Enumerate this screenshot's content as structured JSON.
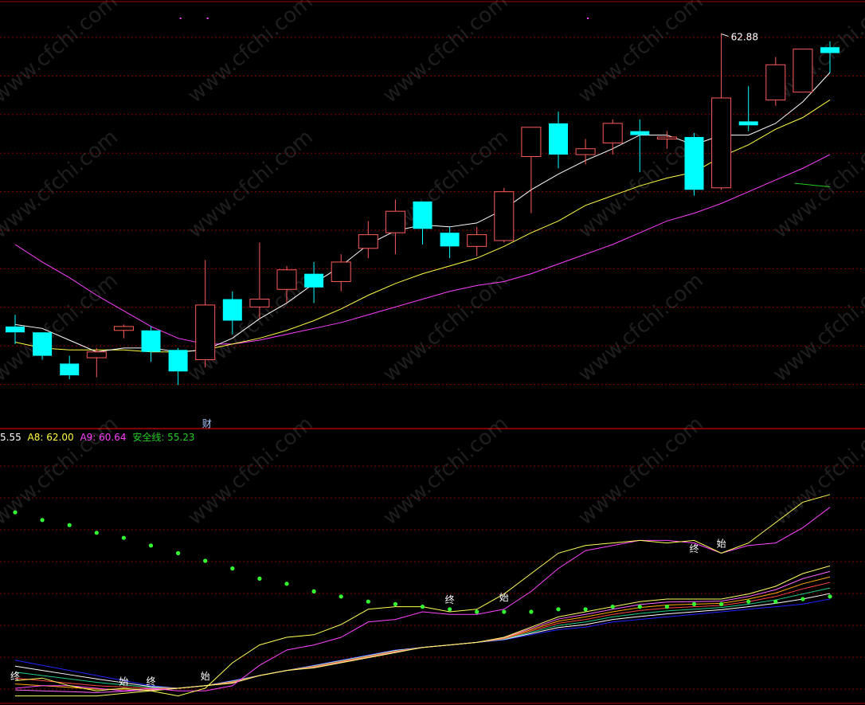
{
  "colors": {
    "up": "#ff5a5a",
    "down": "#00ffff",
    "ma1": "#ffffff",
    "ma2": "#ffff40",
    "ma3": "#ff40ff",
    "safety_line": "#22cc22",
    "grid": "#8b0000",
    "divider": "#aa0000",
    "dots": "#33ff33",
    "lower_yellow": "#ffff55",
    "lower_magenta": "#ff44ff"
  },
  "watermark": "www.cfchi.com",
  "legend": [
    {
      "text": "5.55",
      "color": "#ffffff"
    },
    {
      "text": "A8: 62.00",
      "color": "#ffff40"
    },
    {
      "text": "A9: 60.64",
      "color": "#ff40ff"
    },
    {
      "text": "安全线: 55.23",
      "color": "#22cc22"
    }
  ],
  "annotations": {
    "high_price": "62.88",
    "event_marker": "财",
    "start_label": "始",
    "end_label": "终"
  },
  "chart_data": [
    {
      "type": "candlestick",
      "title": "",
      "ylim": [
        43.0,
        63.8
      ],
      "candles": [
        {
          "o": 47.9,
          "h": 48.5,
          "l": 47.0,
          "c": 47.6
        },
        {
          "o": 47.6,
          "h": 47.6,
          "l": 46.2,
          "c": 46.4
        },
        {
          "o": 46.0,
          "h": 46.4,
          "l": 45.2,
          "c": 45.4
        },
        {
          "o": 46.3,
          "h": 46.8,
          "l": 45.3,
          "c": 46.6
        },
        {
          "o": 47.7,
          "h": 48.0,
          "l": 47.3,
          "c": 47.9
        },
        {
          "o": 47.7,
          "h": 47.9,
          "l": 46.1,
          "c": 46.6
        },
        {
          "o": 46.7,
          "h": 46.8,
          "l": 44.9,
          "c": 45.6
        },
        {
          "o": 46.2,
          "h": 51.3,
          "l": 45.8,
          "c": 49.0
        },
        {
          "o": 49.3,
          "h": 49.7,
          "l": 47.5,
          "c": 48.2
        },
        {
          "o": 48.9,
          "h": 52.2,
          "l": 48.3,
          "c": 49.3
        },
        {
          "o": 49.8,
          "h": 51.0,
          "l": 49.1,
          "c": 50.8
        },
        {
          "o": 50.6,
          "h": 51.2,
          "l": 49.1,
          "c": 49.9
        },
        {
          "o": 50.2,
          "h": 51.6,
          "l": 49.7,
          "c": 51.2
        },
        {
          "o": 51.9,
          "h": 53.3,
          "l": 51.4,
          "c": 52.6
        },
        {
          "o": 52.7,
          "h": 54.4,
          "l": 51.6,
          "c": 53.8
        },
        {
          "o": 54.3,
          "h": 54.3,
          "l": 52.1,
          "c": 52.9
        },
        {
          "o": 52.7,
          "h": 53.0,
          "l": 51.4,
          "c": 52.0
        },
        {
          "o": 52.0,
          "h": 53.0,
          "l": 51.5,
          "c": 52.6
        },
        {
          "o": 52.3,
          "h": 55.0,
          "l": 52.2,
          "c": 54.8
        },
        {
          "o": 56.6,
          "h": 57.2,
          "l": 53.7,
          "c": 58.1
        },
        {
          "o": 58.3,
          "h": 58.9,
          "l": 56.0,
          "c": 56.7
        },
        {
          "o": 56.7,
          "h": 57.5,
          "l": 56.2,
          "c": 57.0
        },
        {
          "o": 57.3,
          "h": 58.5,
          "l": 56.7,
          "c": 58.3
        },
        {
          "o": 57.9,
          "h": 58.5,
          "l": 55.8,
          "c": 57.7
        },
        {
          "o": 57.5,
          "h": 57.9,
          "l": 57.0,
          "c": 57.6
        },
        {
          "o": 57.6,
          "h": 57.8,
          "l": 54.6,
          "c": 54.9
        },
        {
          "o": 55.0,
          "h": 62.9,
          "l": 54.9,
          "c": 59.6
        },
        {
          "o": 58.4,
          "h": 60.2,
          "l": 57.9,
          "c": 58.2
        },
        {
          "o": 59.5,
          "h": 61.7,
          "l": 59.2,
          "c": 61.3
        },
        {
          "o": 59.9,
          "h": 61.7,
          "l": 59.9,
          "c": 62.1
        },
        {
          "o": 62.2,
          "h": 62.5,
          "l": 60.9,
          "c": 61.9
        }
      ],
      "ma_white": [
        48.0,
        47.8,
        47.2,
        46.6,
        46.8,
        46.8,
        46.6,
        46.7,
        47.3,
        48.3,
        49.1,
        50.1,
        51.0,
        52.1,
        52.8,
        53.1,
        53.0,
        53.2,
        53.9,
        54.9,
        55.7,
        56.4,
        57.0,
        57.7,
        57.7,
        57.2,
        57.7,
        57.7,
        58.3,
        59.4,
        60.9
      ],
      "ma_yellow": [
        47.1,
        46.8,
        46.7,
        46.7,
        46.7,
        46.6,
        46.6,
        46.7,
        47.0,
        47.3,
        47.7,
        48.2,
        48.8,
        49.5,
        50.1,
        50.6,
        51.0,
        51.4,
        52.0,
        52.7,
        53.3,
        54.1,
        54.6,
        55.1,
        55.5,
        55.8,
        56.6,
        57.2,
        58.0,
        58.6,
        59.5
      ],
      "ma_magenta": [
        52.1,
        51.2,
        50.4,
        49.5,
        48.7,
        47.9,
        47.3,
        47.0,
        47.0,
        47.2,
        47.5,
        47.8,
        48.1,
        48.5,
        48.9,
        49.3,
        49.7,
        50.0,
        50.2,
        50.6,
        51.1,
        51.6,
        52.1,
        52.7,
        53.3,
        53.7,
        54.2,
        54.8,
        55.4,
        56.0,
        56.7
      ],
      "safety_line": {
        "x_from": 28.7,
        "x_to": 30.0,
        "values": [
          55.23,
          55.05
        ]
      },
      "high_label": {
        "index": 26,
        "value": 62.88
      }
    },
    {
      "type": "line",
      "title": "",
      "ylim": [
        0,
        100
      ],
      "dots": [
        74,
        71,
        69,
        66,
        64,
        61,
        58,
        55,
        52,
        48,
        46,
        43,
        41,
        39,
        38,
        37,
        36,
        35,
        35,
        35,
        36,
        36,
        37,
        37,
        37,
        38,
        38,
        39,
        39,
        40,
        41
      ],
      "yellow": [
        8,
        9,
        6,
        4,
        5,
        4,
        2,
        5,
        15,
        22,
        25,
        26,
        30,
        36,
        37,
        37,
        35,
        36,
        42,
        50,
        58,
        61,
        62,
        63,
        62,
        63,
        58,
        62,
        70,
        78,
        81
      ],
      "magenta": [
        5,
        6,
        6,
        5,
        4,
        5,
        4,
        4,
        6,
        14,
        20,
        22,
        25,
        31,
        32,
        35,
        34,
        34,
        36,
        43,
        52,
        59,
        61,
        63,
        63,
        62,
        58,
        61,
        62,
        68,
        76
      ],
      "ribbon_low": [
        16,
        14,
        12,
        10,
        8,
        6,
        5,
        6,
        8,
        10,
        12,
        14,
        16,
        18,
        20,
        21,
        22,
        23,
        24,
        26,
        28,
        29,
        31,
        32,
        33,
        34,
        35,
        36,
        37,
        38,
        40
      ],
      "ribbon_high": [
        2,
        2,
        2,
        2,
        3,
        4,
        5,
        6,
        7,
        10,
        12,
        13,
        15,
        17,
        19,
        21,
        22,
        23,
        25,
        29,
        33,
        35,
        37,
        39,
        40,
        40,
        40,
        42,
        45,
        50,
        53
      ],
      "marks": [
        {
          "index": 0,
          "label_key": "end_label",
          "value": 10
        },
        {
          "index": 4,
          "label_key": "start_label",
          "value": 8
        },
        {
          "index": 5,
          "label_key": "end_label",
          "value": 8
        },
        {
          "index": 7,
          "label_key": "start_label",
          "value": 10
        },
        {
          "index": 16,
          "label_key": "end_label",
          "value": 40
        },
        {
          "index": 18,
          "label_key": "start_label",
          "value": 41
        },
        {
          "index": 25,
          "label_key": "end_label",
          "value": 60
        },
        {
          "index": 26,
          "label_key": "start_label",
          "value": 62
        }
      ]
    }
  ]
}
